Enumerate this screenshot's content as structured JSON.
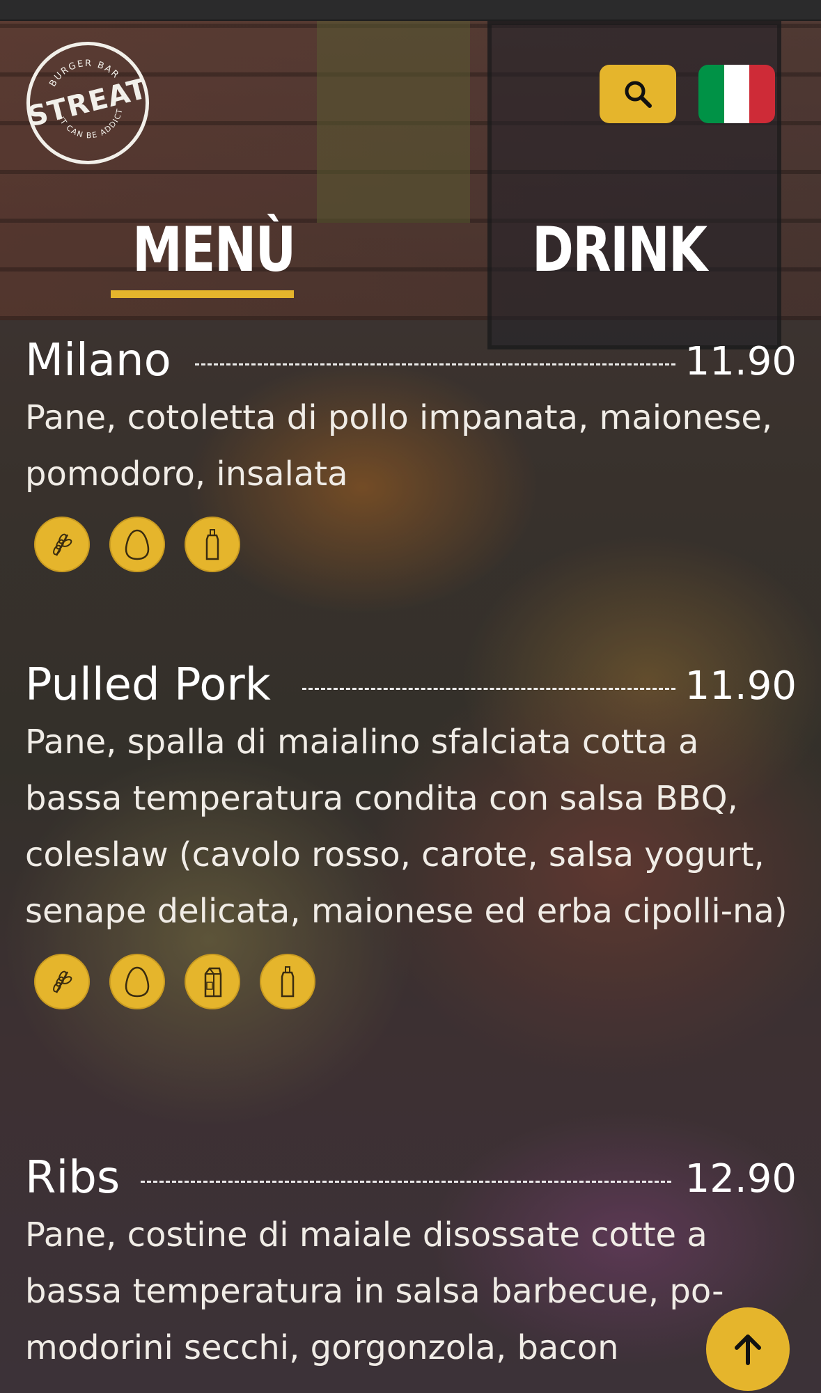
{
  "header": {
    "logo": {
      "top_text": "BURGER BAR",
      "main_text": "STREAT",
      "bottom_text": "IT CAN BE ADDICTIVE",
      "icon": "streat-logo"
    },
    "search_icon": "search-icon",
    "language_flag": "italian-flag-icon",
    "colors": {
      "accent": "#e5b52c",
      "flag_green": "#009246",
      "flag_white": "#ffffff",
      "flag_red": "#ce2b37"
    }
  },
  "tabs": [
    {
      "label": "MENÙ",
      "active": true
    },
    {
      "label": "DRINK",
      "active": false
    }
  ],
  "items": [
    {
      "name": "Milano",
      "price": "11.90",
      "description": "Pane, cotoletta di pollo impanata, maionese, pomodoro, insalata",
      "allergens": [
        "gluten-icon",
        "egg-icon",
        "mustard-icon"
      ]
    },
    {
      "name": "Pulled Pork",
      "price": "11.90",
      "description": "Pane, spalla di maialino sfalciata cotta a bassa temperatura condita con salsa BBQ, coleslaw (cavolo rosso, carote, salsa yogurt, senape delicata, maionese ed erba cipolli-na)",
      "allergens": [
        "gluten-icon",
        "egg-icon",
        "milk-icon",
        "mustard-icon"
      ]
    },
    {
      "name": "Ribs",
      "price": "12.90",
      "description": "Pane, costine di maiale disossate cotte a bassa temperatura in salsa barbecue, po-modorini secchi, gorgonzola, bacon",
      "allergens": []
    }
  ],
  "scroll_to_top_icon": "arrow-up-icon"
}
